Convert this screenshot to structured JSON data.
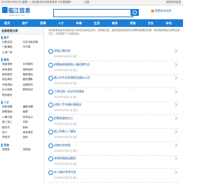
{
  "topbar": {
    "left": "2020年03月02日 星期一  | 欢迎您访问分类信息网 今天是星期一",
    "link": "注册",
    "right": "免费发布信息"
  },
  "logo": {
    "title": "临江信息",
    "url": "www.xjlinx.com"
  },
  "search": {
    "placeholder": ""
  },
  "publish": {
    "label": "免费发布信息"
  },
  "nav": [
    "首页",
    "房产",
    "招聘",
    "人才",
    "车辆",
    "生活",
    "商务",
    "宠物",
    "交友",
    "本地"
  ],
  "sidebar": {
    "header": "全部信息分类",
    "sections": [
      {
        "title": "房产",
        "items": [
          "出售买卖",
          "住宅出租求租",
          "门面铺面",
          "写字楼",
          "土地厂房",
          ""
        ]
      },
      {
        "title": "服务",
        "items": [
          "电脑维修",
          "手机数码",
          "家电维修",
          "装修装饰",
          "家政服务",
          "搬家搬运",
          "保洁清洗",
          "婚庆摄影",
          "开锁修锁",
          "运输物流",
          "办公家具",
          "教育培训",
          "更多服务",
          ""
        ]
      },
      {
        "title": "人才",
        "items": [
          "求职招聘",
          "兼职招聘",
          "销售营销",
          "客服",
          "人事行政",
          "财务会计",
          "普工技工",
          "司机",
          "服务员",
          "厨师",
          "设计",
          "美容美发",
          "导购员",
          "保安"
        ]
      },
      {
        "title": "宠物",
        "items": [
          "宠物狗",
          "宠物猫"
        ]
      }
    ]
  },
  "intro": "本站所有信息均为网友自行发布并由网友负责，请谨慎交易，如发现违规信息请立即联系管理员处理，请勿相信转账汇款等交易方式，注意保护个人信息安全。",
  "listings": [
    {
      "title": "求租公寓住房",
      "meta": "2020年03月02日  临江"
    },
    {
      "title": "招聘厨师助理和人事招聘专员",
      "meta": "2020年03月02日  临江"
    },
    {
      "title": "临江市专业家政保洁服务公司",
      "meta": "2020年03月02日  临江"
    },
    {
      "title": "工商注册一站式代办服务",
      "meta": "2020年03月02日  临江"
    },
    {
      "title": "出售二手车辆价格面议",
      "meta": "2020年03月02日  临江"
    },
    {
      "title": "招聘家政钟点工",
      "meta": "2020年03月02日  临江"
    },
    {
      "title": "临江家教上门辅导",
      "meta": "2020年03月02日  临江"
    },
    {
      "title": "出售住宅房屋",
      "meta": "2020年03月02日  临江"
    },
    {
      "title": "本地同城快运搬家",
      "meta": "2020年03月02日  临江"
    },
    {
      "title": "本人临时寻求代卖",
      "meta": "2020年03月02日  临江"
    }
  ]
}
